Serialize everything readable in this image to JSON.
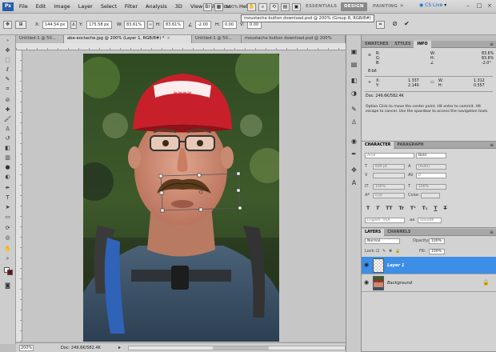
{
  "app": {
    "badge": "Ps",
    "menu": [
      "File",
      "Edit",
      "Image",
      "Layer",
      "Select",
      "Filter",
      "Analysis",
      "3D",
      "View",
      "Window",
      "Help"
    ],
    "zoom_level": "100%",
    "workspaces": [
      "ESSENTIALS",
      "DESIGN",
      "PAINTING"
    ],
    "active_workspace": "DESIGN",
    "cslive": "CS Live",
    "window_controls": [
      "–",
      "□",
      "×"
    ]
  },
  "options": {
    "x_label": "X:",
    "x_value": "144.54 px",
    "y_label": "Y:",
    "y_value": "175.58 px",
    "w_label": "W:",
    "w_value": "83.61%",
    "h_label": "H:",
    "h_value": "83.61%",
    "angle_value": "-2.00",
    "hskew_label": "H:",
    "hskew_value": "0.00",
    "vskew_label": "V:",
    "vskew_value": "0.00",
    "commit": "✔",
    "cancel": "⊘"
  },
  "tooltip": "moustache button download.psd @ 200% (Group 8, RGB/8#)",
  "tabs": [
    {
      "label": "Untitled-1 @ 50...",
      "active": false
    },
    {
      "label": "abe-eoctache.jpg @ 200% (Layer 1, RGB/8#) *",
      "active": true
    },
    {
      "label": "Untitled-1 @ 50...",
      "active": false
    },
    {
      "label": "moustache button download.psd @ 200%",
      "active": false
    }
  ],
  "status": {
    "zoom": "200%",
    "doc": "Doc: 249.6K/582.4K"
  },
  "info_panel": {
    "tabs": [
      "SWATCHES",
      "STYLES",
      "INFO"
    ],
    "active_tab": "INFO",
    "r_lbl": "R:",
    "g_lbl": "G:",
    "b_lbl": "B:",
    "w_lbl": "W:",
    "h_lbl": "H:",
    "w_val": "83.6%",
    "h_val": "83.6%",
    "a_val": "-2.0°",
    "bit": "8-bit",
    "x_lbl": "X:",
    "y_lbl": "Y:",
    "x_val": "1.337",
    "y_val": "2.140",
    "w2_lbl": "W:",
    "h2_lbl": "H:",
    "w2_val": "1.312",
    "h2_val": "0.557",
    "doc": "Doc: 249.6K/582.4K",
    "hint": "Option Click to move the center point. Hit enter to commit. Hit escape to cancel. Use the spacebar to access the navigation tools."
  },
  "character_panel": {
    "tabs": [
      "CHARACTER",
      "PARAGRAPH"
    ],
    "active_tab": "CHARACTER",
    "font": "Arial",
    "style": "Bold",
    "size": "600 pt",
    "leading": "(Auto)",
    "kerning": "",
    "tracking": "0",
    "vscale": "100%",
    "hscale": "100%",
    "baseline": "0 pt",
    "color_label": "Color:",
    "glyphs": [
      "T",
      "T",
      "TT",
      "Tr",
      "T¹",
      "T₁",
      "T",
      "T"
    ],
    "language": "English: USA",
    "aa_label": "aa",
    "antialias": "Smooth"
  },
  "layers_panel": {
    "tabs": [
      "LAYERS",
      "CHANNELS"
    ],
    "active_tab": "LAYERS",
    "blend_mode": "Normal",
    "opacity_label": "Opacity:",
    "opacity": "100%",
    "lock_label": "Lock:",
    "fill_label": "Fill:",
    "fill": "100%",
    "layers": [
      {
        "name": "Layer 1",
        "selected": true
      },
      {
        "name": "Background",
        "selected": false
      }
    ]
  },
  "colors": {
    "selection": "#3d8ee6",
    "ps_badge": "#2a5ea8",
    "cap_red": "#c7202a"
  }
}
